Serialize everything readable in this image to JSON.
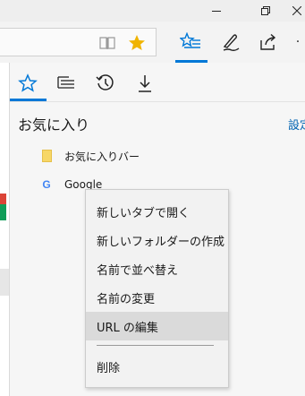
{
  "hub": {
    "title": "お気に入り",
    "settings_label": "設定"
  },
  "favorites": [
    {
      "label": "お気に入りバー",
      "icon": "folder-icon"
    },
    {
      "label": "Google",
      "icon": "google-icon",
      "icon_glyph": "G"
    }
  ],
  "context_menu": {
    "items": [
      "新しいタブで開く",
      "新しいフォルダーの作成",
      "名前で並べ替え",
      "名前の変更",
      "URL の編集"
    ],
    "highlighted": "URL の編集",
    "delete_label": "削除"
  },
  "colors": {
    "accent": "#0078d7",
    "favorite_star": "#f0b400",
    "folder": "#f7d767",
    "menu_highlight": "#dadada",
    "link": "#0063b1"
  }
}
